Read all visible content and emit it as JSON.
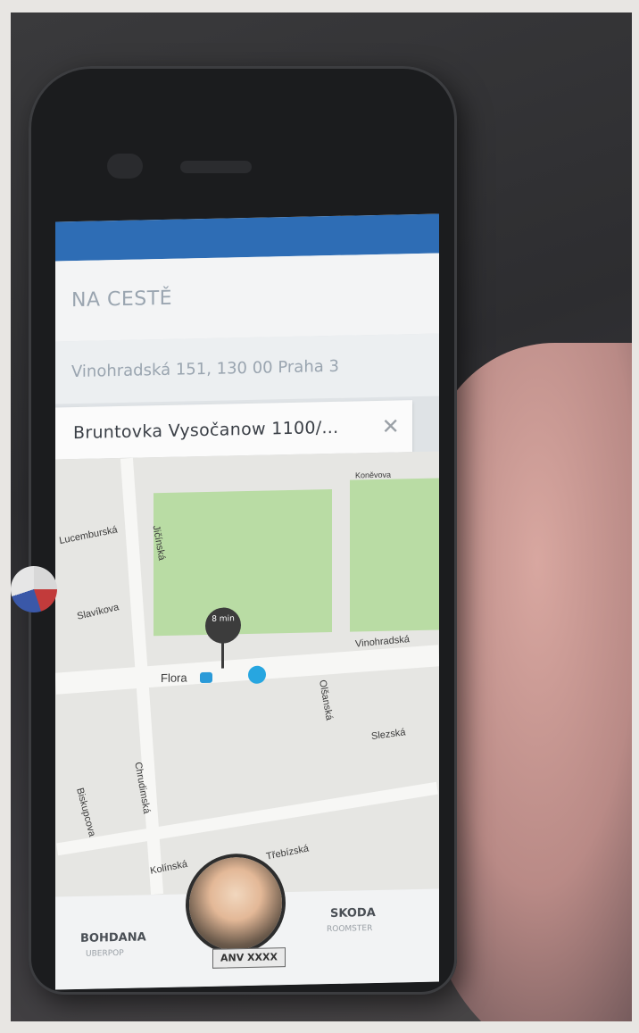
{
  "status_bar": {
    "text": ""
  },
  "trip": {
    "status_title": "NA CESTĚ",
    "origin": "Vinohradská 151, 130 00 Praha 3",
    "destination": "Bruntovka Vysočanow 1100/...",
    "destination_clear_icon": "close-icon"
  },
  "map": {
    "streets": [
      "Lucemburská",
      "Jičínská",
      "Slavíkova",
      "Vinohradská",
      "Flora",
      "Chrudimská",
      "Olšanská",
      "Slezská",
      "Kolínská",
      "Biskupcova",
      "Třebízská",
      "Koněvova"
    ],
    "pin_label": "8 min"
  },
  "driver": {
    "name": "BOHDANA",
    "subtitle": "UBERPOP",
    "plate": "ANV XXXX"
  },
  "car": {
    "model": "SKODA",
    "subtitle": "ROOMSTER"
  },
  "colors": {
    "status_bar": "#2e6db5",
    "park": "#b9dca4",
    "pin": "#3c3c3c",
    "metro": "#2a9ad8"
  }
}
